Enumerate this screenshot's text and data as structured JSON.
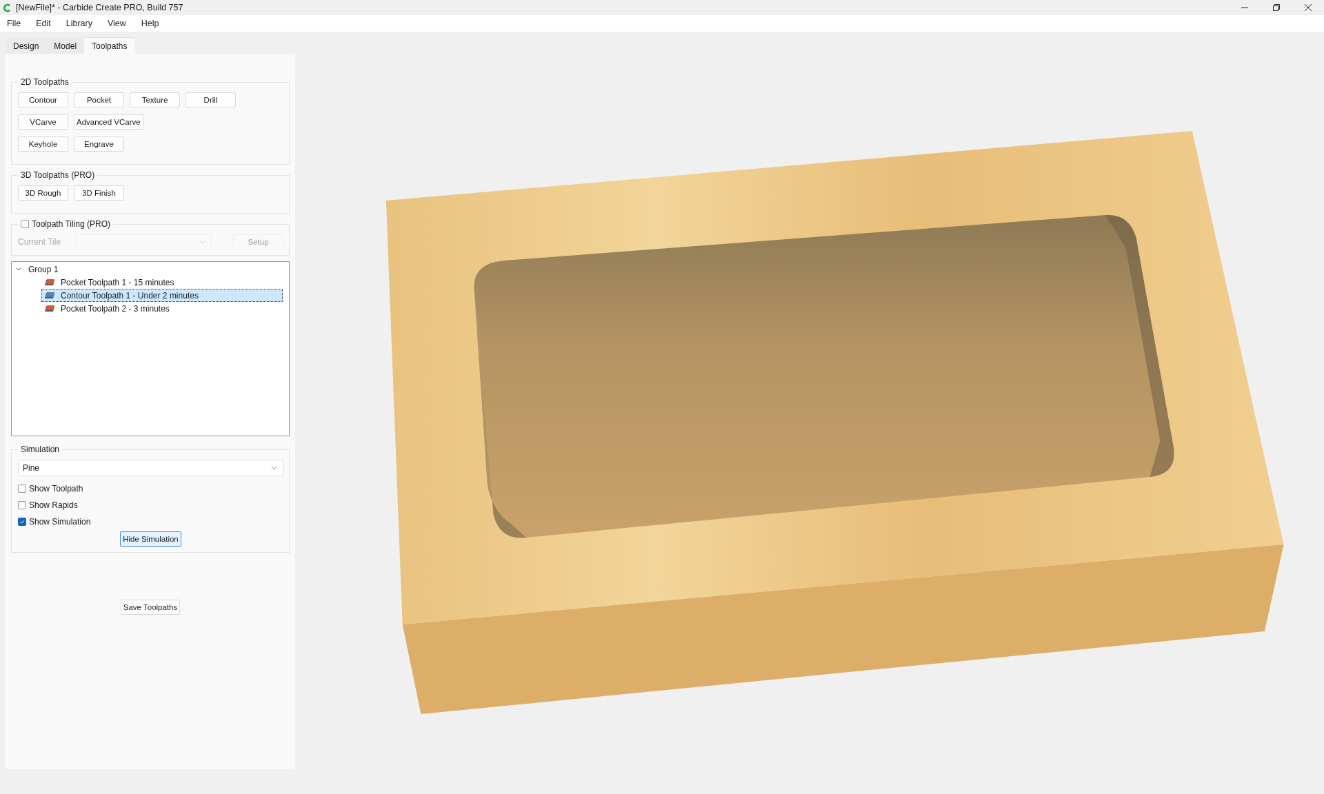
{
  "window": {
    "title": "[NewFile]* - Carbide Create PRO, Build 757"
  },
  "menu": [
    {
      "label": "File"
    },
    {
      "label": "Edit"
    },
    {
      "label": "Library"
    },
    {
      "label": "View"
    },
    {
      "label": "Help"
    }
  ],
  "tabs": [
    {
      "label": "Design",
      "selected": false
    },
    {
      "label": "Model",
      "selected": false
    },
    {
      "label": "Toolpaths",
      "selected": true
    }
  ],
  "toolpaths_2d": {
    "title": "2D Toolpaths",
    "rows": [
      [
        "Contour",
        "Pocket",
        "Texture",
        "Drill"
      ],
      [
        "VCarve",
        "Advanced VCarve"
      ],
      [
        "Keyhole",
        "Engrave"
      ]
    ]
  },
  "toolpaths_3d": {
    "title": "3D Toolpaths (PRO)",
    "buttons": [
      "3D Rough",
      "3D Finish"
    ]
  },
  "tiling": {
    "label": "Toolpath Tiling (PRO)",
    "checked": false,
    "current_tile_label": "Current Tile",
    "setup_button": "Setup",
    "disabled": true
  },
  "tree": [
    {
      "label": "Group 1",
      "expanded": true,
      "children": [
        {
          "label": "Pocket Toolpath 1 - 15 minutes",
          "kind": "pocket",
          "selected": false
        },
        {
          "label": "Contour Toolpath 1 - Under 2 minutes",
          "kind": "contour",
          "selected": true
        },
        {
          "label": "Pocket Toolpath 2 - 3 minutes",
          "kind": "pocket",
          "selected": false
        }
      ]
    }
  ],
  "simulation": {
    "title": "Simulation",
    "material": "Pine",
    "options": [
      {
        "label": "Show Toolpath",
        "checked": false
      },
      {
        "label": "Show Rapids",
        "checked": false
      },
      {
        "label": "Show Simulation",
        "checked": true
      }
    ],
    "button": "Hide Simulation"
  },
  "save_button": "Save Toolpaths"
}
